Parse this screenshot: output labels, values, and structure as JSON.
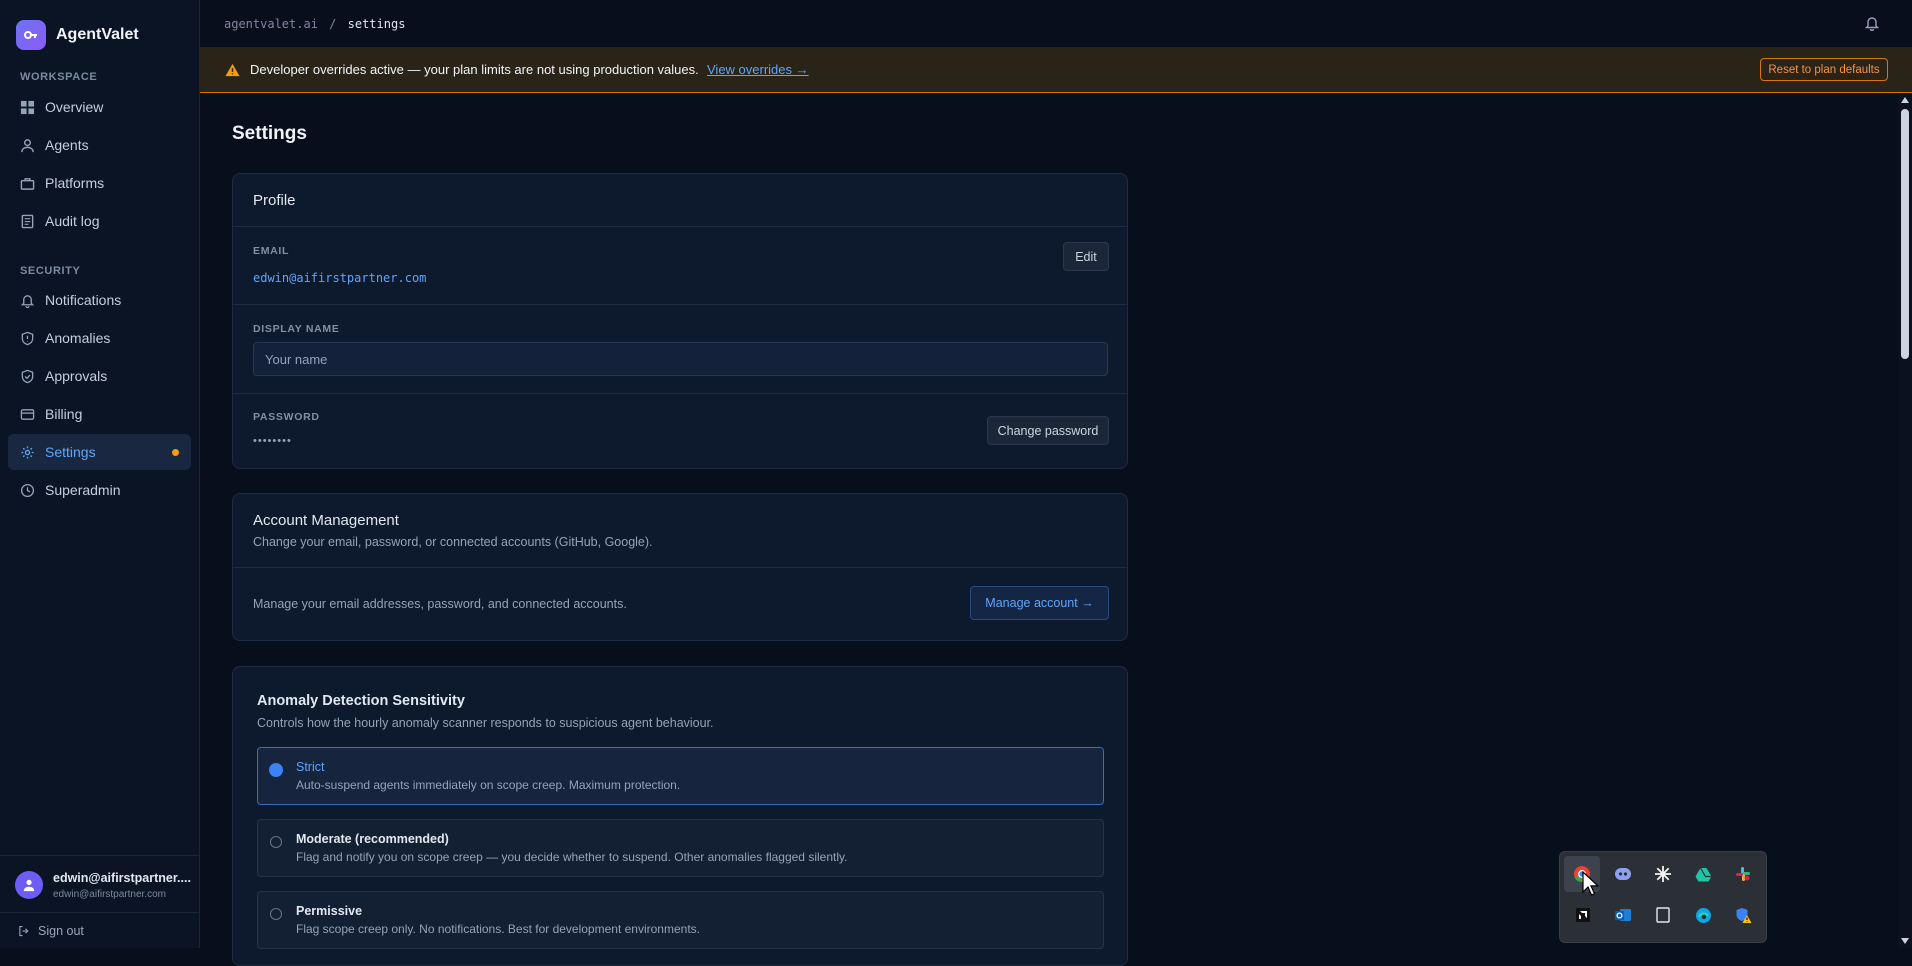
{
  "app": {
    "name": "AgentValet"
  },
  "sidebar": {
    "workspace_label": "WORKSPACE",
    "security_label": "SECURITY",
    "workspace_items": [
      {
        "label": "Overview",
        "icon": "grid-icon"
      },
      {
        "label": "Agents",
        "icon": "user-icon"
      },
      {
        "label": "Platforms",
        "icon": "briefcase-icon"
      },
      {
        "label": "Audit log",
        "icon": "document-icon"
      }
    ],
    "security_items": [
      {
        "label": "Notifications",
        "icon": "bell-icon"
      },
      {
        "label": "Anomalies",
        "icon": "shield-icon"
      },
      {
        "label": "Approvals",
        "icon": "shield-check-icon"
      },
      {
        "label": "Billing",
        "icon": "credit-card-icon"
      },
      {
        "label": "Settings",
        "icon": "gear-icon",
        "active": true
      },
      {
        "label": "Superadmin",
        "icon": "clock-icon"
      }
    ],
    "user": {
      "name": "edwin@aifirstpartner....",
      "email": "edwin@aifirstpartner.com"
    },
    "sign_out": "Sign out"
  },
  "topbar": {
    "domain": "agentvalet.ai",
    "separator": "/",
    "current": "settings"
  },
  "banner": {
    "text": "Developer overrides active — your plan limits are not using production values.",
    "link": "View overrides →",
    "reset_button": "Reset to plan defaults"
  },
  "page": {
    "title": "Settings"
  },
  "profile": {
    "title": "Profile",
    "email_label": "EMAIL",
    "email_value": "edwin@aifirstpartner.com",
    "edit_button": "Edit",
    "display_name_label": "DISPLAY NAME",
    "display_name_placeholder": "Your name",
    "password_label": "PASSWORD",
    "password_value": "••••••••",
    "change_password_button": "Change password"
  },
  "account": {
    "title": "Account Management",
    "subtitle": "Change your email, password, or connected accounts (GitHub, Google).",
    "description": "Manage your email addresses, password, and connected accounts.",
    "manage_button": "Manage account →"
  },
  "anomaly": {
    "title": "Anomaly Detection Sensitivity",
    "subtitle": "Controls how the hourly anomaly scanner responds to suspicious agent behaviour.",
    "options": [
      {
        "title": "Strict",
        "desc": "Auto-suspend agents immediately on scope creep. Maximum protection.",
        "selected": true
      },
      {
        "title": "Moderate (recommended)",
        "desc": "Flag and notify you on scope creep — you decide whether to suspend. Other anomalies flagged silently.",
        "selected": false
      },
      {
        "title": "Permissive",
        "desc": "Flag scope creep only. No notifications. Best for development environments.",
        "selected": false
      }
    ]
  },
  "colors": {
    "accent": "#60a5fa",
    "warning": "#f59e0b",
    "background": "#070e1c",
    "card": "#0d192d"
  },
  "tray": {
    "icons": [
      "chrome-icon",
      "discord-icon",
      "claude-icon",
      "drive-icon",
      "slack-icon",
      "amd-icon",
      "outlook-icon",
      "notebook-icon",
      "edge-icon",
      "security-warning-icon"
    ]
  }
}
